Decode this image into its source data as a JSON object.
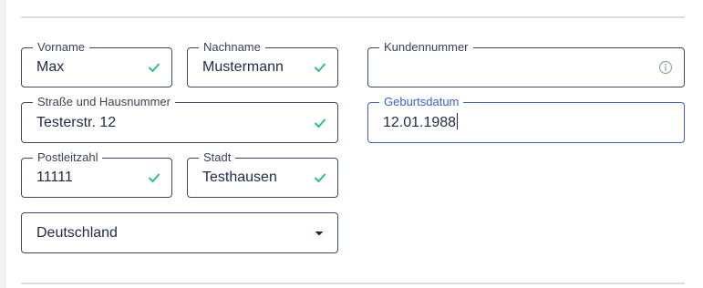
{
  "form": {
    "vorname": {
      "label": "Vorname",
      "value": "Max"
    },
    "nachname": {
      "label": "Nachname",
      "value": "Mustermann"
    },
    "kundennummer": {
      "label": "Kundennummer",
      "value": ""
    },
    "strasse": {
      "label": "Straße und Hausnummer",
      "value": "Testerstr. 12"
    },
    "geburtsdatum": {
      "label": "Geburtsdatum",
      "value": "12.01.1988"
    },
    "postleitzahl": {
      "label": "Postleitzahl",
      "value": "11111"
    },
    "stadt": {
      "label": "Stadt",
      "value": "Testhausen"
    },
    "land": {
      "value": "Deutschland"
    }
  },
  "colors": {
    "check": "#2fbf83",
    "focus": "#3a5fcf",
    "border": "#3a4868",
    "info_icon": "#9aa0aa"
  },
  "icons": {
    "valid": "check-icon",
    "info": "info-icon",
    "dropdown": "chevron-down-icon"
  }
}
